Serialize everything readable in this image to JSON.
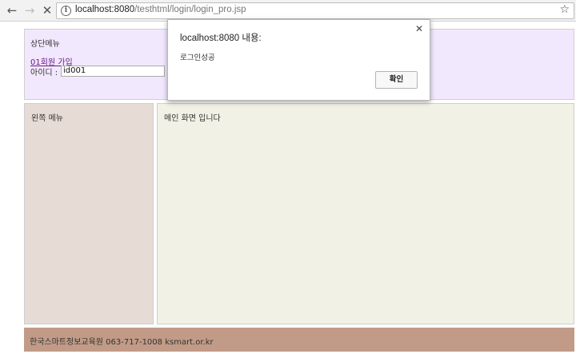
{
  "browser": {
    "url_host": "localhost:8080",
    "url_path": "/testhtml/login/login_pro.jsp",
    "icons": [
      "back-arrow-icon",
      "forward-arrow-icon",
      "stop-icon",
      "info-icon",
      "star-icon"
    ]
  },
  "page": {
    "top_menu": {
      "title": "상단메뉴",
      "join_link": "01회원 가입",
      "id_label": "아이디 :",
      "id_value": "id001",
      "bg_color": "#f2e8fd"
    },
    "left_menu": {
      "title": "왼쪽 메뉴",
      "bg_color": "#e7dbd6"
    },
    "main": {
      "text": "메인 화면 입니다",
      "bg_color": "#f1f1e5"
    },
    "footer": {
      "text": "한국스마트정보교육원 063-717-1008 ksmart.or.kr",
      "bg_color": "#c19b87"
    }
  },
  "dialog": {
    "title": "localhost:8080 내용:",
    "message": "로그인성공",
    "ok_label": "확인"
  }
}
